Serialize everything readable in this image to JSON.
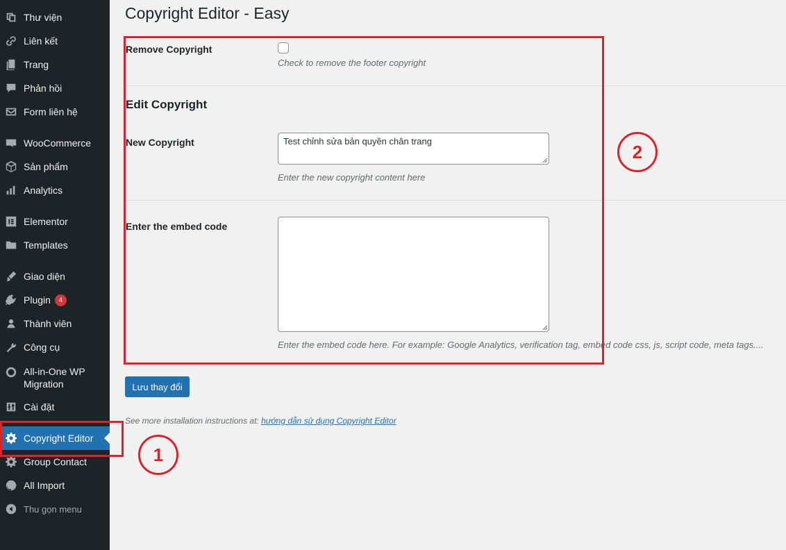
{
  "sidebar": {
    "items": [
      {
        "label": "Thư viện",
        "icon": "media-icon"
      },
      {
        "label": "Liên kết",
        "icon": "link-icon"
      },
      {
        "label": "Trang",
        "icon": "page-icon"
      },
      {
        "label": "Phản hồi",
        "icon": "comment-icon"
      },
      {
        "label": "Form liên hệ",
        "icon": "mail-icon"
      },
      {
        "label": "WooCommerce",
        "icon": "woocommerce-icon"
      },
      {
        "label": "Sản phẩm",
        "icon": "box-icon"
      },
      {
        "label": "Analytics",
        "icon": "bar-chart-icon"
      },
      {
        "label": "Elementor",
        "icon": "elementor-icon"
      },
      {
        "label": "Templates",
        "icon": "folder-icon"
      },
      {
        "label": "Giao diện",
        "icon": "brush-icon"
      },
      {
        "label": "Plugin",
        "icon": "plugin-icon",
        "badge": "4"
      },
      {
        "label": "Thành viên",
        "icon": "user-icon"
      },
      {
        "label": "Công cụ",
        "icon": "wrench-icon"
      },
      {
        "label": "All-in-One WP Migration",
        "icon": "migration-icon"
      },
      {
        "label": "Cài đặt",
        "icon": "settings-sliders-icon"
      },
      {
        "label": "Copyright Editor",
        "icon": "gear-icon",
        "active": true
      },
      {
        "label": "Group Contact",
        "icon": "gear-icon"
      },
      {
        "label": "All Import",
        "icon": "import-icon"
      },
      {
        "label": "Thu gọn menu",
        "icon": "collapse-icon"
      }
    ]
  },
  "page": {
    "title": "Copyright Editor - Easy",
    "remove_copyright": {
      "label": "Remove Copyright",
      "checked": false,
      "description": "Check to remove the footer copyright"
    },
    "section_title": "Edit Copyright",
    "new_copyright": {
      "label": "New Copyright",
      "value": "Test chỉnh sửa bản quyền chân trang",
      "description": "Enter the new copyright content here"
    },
    "embed_code": {
      "label": "Enter the embed code",
      "value": "",
      "description": "Enter the embed code here. For example: Google Analytics, verification tag, embed code css, js, script code, meta tags...."
    },
    "save_label": "Lưu thay đổi",
    "help_prefix": "See more installation instructions at: ",
    "help_link": "hướng dẫn sử dụng Copyright Editor"
  },
  "annotations": {
    "marker_1": "1",
    "marker_2": "2",
    "color": "#d9232d"
  },
  "colors": {
    "sidebar_bg": "#1d2327",
    "accent": "#2271b1",
    "badge": "#d63638"
  }
}
